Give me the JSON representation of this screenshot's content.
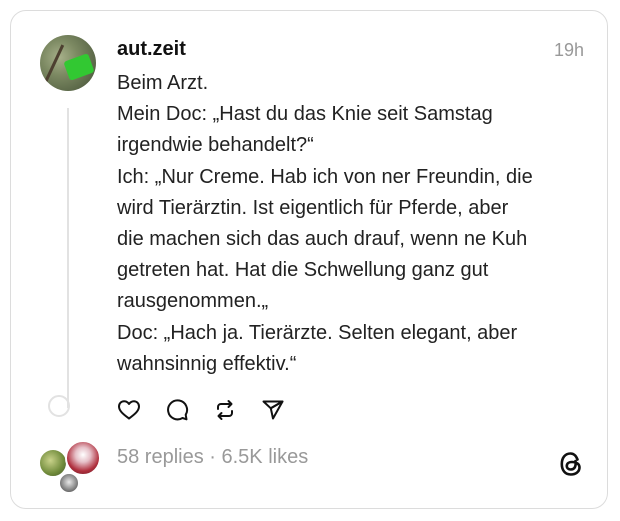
{
  "post": {
    "username": "aut.zeit",
    "time": "19h",
    "lines": [
      "Beim Arzt.",
      "Mein Doc: „Hast du das Knie seit Samstag",
      "irgendwie behandelt?“",
      "Ich: „Nur Creme. Hab ich von ner Freundin, die",
      "wird Tierärztin. Ist eigentlich für Pferde, aber",
      "die machen sich das auch drauf, wenn ne Kuh",
      "getreten hat. Hat die Schwellung ganz gut",
      "rausgenommen.„",
      "Doc: „Hach ja. Tierärzte. Selten elegant, aber",
      "wahnsinnig effektiv.“"
    ],
    "replies": "58 replies",
    "separator": " · ",
    "likes": "6.5K likes"
  },
  "icons": {
    "like": "heart-icon",
    "reply": "comment-icon",
    "repost": "repost-icon",
    "share": "send-icon",
    "brand": "threads-logo-icon"
  },
  "colors": {
    "text": "#222222",
    "muted": "#999999",
    "border": "#dcdcdc"
  }
}
